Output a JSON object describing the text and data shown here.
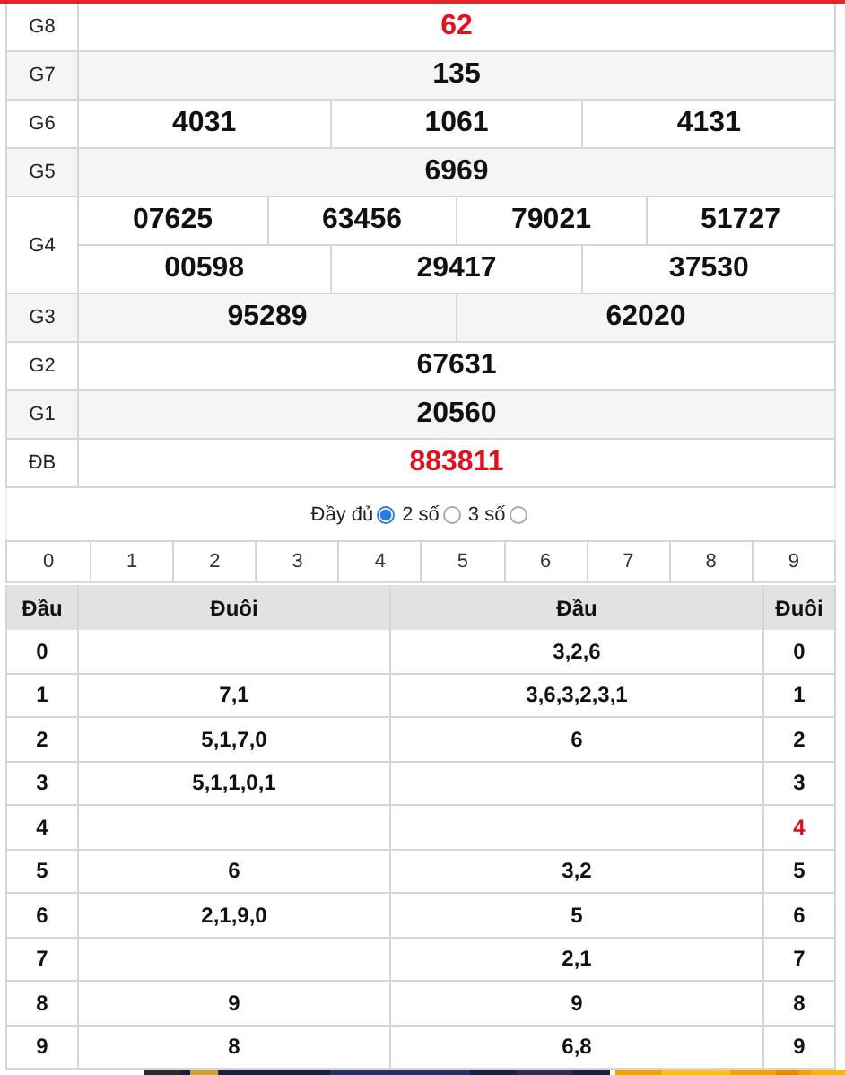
{
  "prizes": [
    {
      "label": "G8",
      "numbers": [
        [
          "62"
        ]
      ],
      "highlight": true
    },
    {
      "label": "G7",
      "numbers": [
        [
          "135"
        ]
      ],
      "highlight": false
    },
    {
      "label": "G6",
      "numbers": [
        [
          "4031",
          "1061",
          "4131"
        ]
      ],
      "highlight": false
    },
    {
      "label": "G5",
      "numbers": [
        [
          "6969"
        ]
      ],
      "highlight": false
    },
    {
      "label": "G4",
      "numbers": [
        [
          "07625",
          "63456",
          "79021",
          "51727"
        ],
        [
          "00598",
          "29417",
          "37530"
        ]
      ],
      "highlight": false
    },
    {
      "label": "G3",
      "numbers": [
        [
          "95289",
          "62020"
        ]
      ],
      "highlight": false
    },
    {
      "label": "G2",
      "numbers": [
        [
          "67631"
        ]
      ],
      "highlight": false
    },
    {
      "label": "G1",
      "numbers": [
        [
          "20560"
        ]
      ],
      "highlight": false
    },
    {
      "label": "ĐB",
      "numbers": [
        [
          "883811"
        ]
      ],
      "highlight": true
    }
  ],
  "display_options": [
    {
      "label": "Đầy đủ",
      "selected": true
    },
    {
      "label": "2 số",
      "selected": false
    },
    {
      "label": "3 số",
      "selected": false
    }
  ],
  "digit_filter": [
    "0",
    "1",
    "2",
    "3",
    "4",
    "5",
    "6",
    "7",
    "8",
    "9"
  ],
  "loto_table": {
    "columns": [
      "Đầu",
      "Đuôi",
      "Đầu",
      "Đuôi"
    ],
    "rows": [
      {
        "head": "0",
        "tails": "",
        "heads": "3,2,6",
        "tail": "0",
        "highlight": false
      },
      {
        "head": "1",
        "tails": "7,1",
        "heads": "3,6,3,2,3,1",
        "tail": "1",
        "highlight": false
      },
      {
        "head": "2",
        "tails": "5,1,7,0",
        "heads": "6",
        "tail": "2",
        "highlight": false
      },
      {
        "head": "3",
        "tails": "5,1,1,0,1",
        "heads": "",
        "tail": "3",
        "highlight": false
      },
      {
        "head": "4",
        "tails": "",
        "heads": "",
        "tail": "4",
        "highlight": true
      },
      {
        "head": "5",
        "tails": "6",
        "heads": "3,2",
        "tail": "5",
        "highlight": false
      },
      {
        "head": "6",
        "tails": "2,1,9,0",
        "heads": "5",
        "tail": "6",
        "highlight": false
      },
      {
        "head": "7",
        "tails": "",
        "heads": "2,1",
        "tail": "7",
        "highlight": false
      },
      {
        "head": "8",
        "tails": "9",
        "heads": "9",
        "tail": "8",
        "highlight": false
      },
      {
        "head": "9",
        "tails": "8",
        "heads": "6,8",
        "tail": "9",
        "highlight": false
      }
    ]
  }
}
